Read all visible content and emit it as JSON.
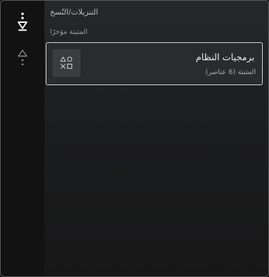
{
  "nav": {
    "items": [
      {
        "icon": "downloads-icon",
        "active": true
      },
      {
        "icon": "playstation-triangle-icon",
        "active": false
      }
    ]
  },
  "breadcrumb": "التنزيلات/النُسخ",
  "section": {
    "title": "المثبتة مؤخرًا"
  },
  "items": [
    {
      "title": "برمجيات النظام",
      "subtitle": "المثبتة (6 عناصر)",
      "icon": "ps-shapes-icon"
    }
  ],
  "colors": {
    "accent_border": "#d8d8d8",
    "background": "#161616"
  }
}
